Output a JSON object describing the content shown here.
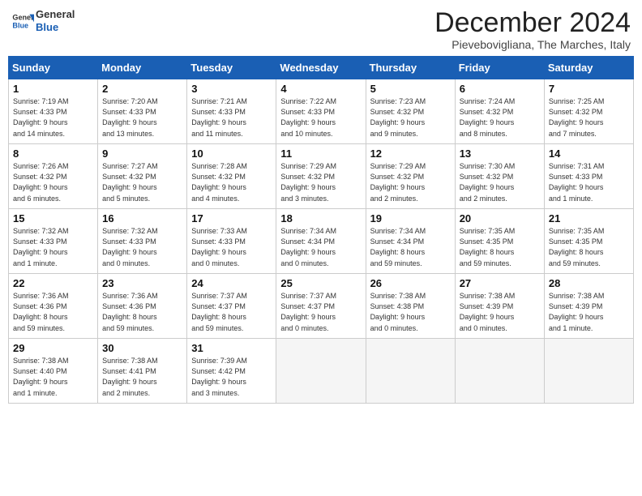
{
  "header": {
    "logo_line1": "General",
    "logo_line2": "Blue",
    "title": "December 2024",
    "subtitle": "Pievebovigliana, The Marches, Italy"
  },
  "days_of_week": [
    "Sunday",
    "Monday",
    "Tuesday",
    "Wednesday",
    "Thursday",
    "Friday",
    "Saturday"
  ],
  "weeks": [
    [
      {
        "day": 1,
        "info": "Sunrise: 7:19 AM\nSunset: 4:33 PM\nDaylight: 9 hours\nand 14 minutes."
      },
      {
        "day": 2,
        "info": "Sunrise: 7:20 AM\nSunset: 4:33 PM\nDaylight: 9 hours\nand 13 minutes."
      },
      {
        "day": 3,
        "info": "Sunrise: 7:21 AM\nSunset: 4:33 PM\nDaylight: 9 hours\nand 11 minutes."
      },
      {
        "day": 4,
        "info": "Sunrise: 7:22 AM\nSunset: 4:33 PM\nDaylight: 9 hours\nand 10 minutes."
      },
      {
        "day": 5,
        "info": "Sunrise: 7:23 AM\nSunset: 4:32 PM\nDaylight: 9 hours\nand 9 minutes."
      },
      {
        "day": 6,
        "info": "Sunrise: 7:24 AM\nSunset: 4:32 PM\nDaylight: 9 hours\nand 8 minutes."
      },
      {
        "day": 7,
        "info": "Sunrise: 7:25 AM\nSunset: 4:32 PM\nDaylight: 9 hours\nand 7 minutes."
      }
    ],
    [
      {
        "day": 8,
        "info": "Sunrise: 7:26 AM\nSunset: 4:32 PM\nDaylight: 9 hours\nand 6 minutes."
      },
      {
        "day": 9,
        "info": "Sunrise: 7:27 AM\nSunset: 4:32 PM\nDaylight: 9 hours\nand 5 minutes."
      },
      {
        "day": 10,
        "info": "Sunrise: 7:28 AM\nSunset: 4:32 PM\nDaylight: 9 hours\nand 4 minutes."
      },
      {
        "day": 11,
        "info": "Sunrise: 7:29 AM\nSunset: 4:32 PM\nDaylight: 9 hours\nand 3 minutes."
      },
      {
        "day": 12,
        "info": "Sunrise: 7:29 AM\nSunset: 4:32 PM\nDaylight: 9 hours\nand 2 minutes."
      },
      {
        "day": 13,
        "info": "Sunrise: 7:30 AM\nSunset: 4:32 PM\nDaylight: 9 hours\nand 2 minutes."
      },
      {
        "day": 14,
        "info": "Sunrise: 7:31 AM\nSunset: 4:33 PM\nDaylight: 9 hours\nand 1 minute."
      }
    ],
    [
      {
        "day": 15,
        "info": "Sunrise: 7:32 AM\nSunset: 4:33 PM\nDaylight: 9 hours\nand 1 minute."
      },
      {
        "day": 16,
        "info": "Sunrise: 7:32 AM\nSunset: 4:33 PM\nDaylight: 9 hours\nand 0 minutes."
      },
      {
        "day": 17,
        "info": "Sunrise: 7:33 AM\nSunset: 4:33 PM\nDaylight: 9 hours\nand 0 minutes."
      },
      {
        "day": 18,
        "info": "Sunrise: 7:34 AM\nSunset: 4:34 PM\nDaylight: 9 hours\nand 0 minutes."
      },
      {
        "day": 19,
        "info": "Sunrise: 7:34 AM\nSunset: 4:34 PM\nDaylight: 8 hours\nand 59 minutes."
      },
      {
        "day": 20,
        "info": "Sunrise: 7:35 AM\nSunset: 4:35 PM\nDaylight: 8 hours\nand 59 minutes."
      },
      {
        "day": 21,
        "info": "Sunrise: 7:35 AM\nSunset: 4:35 PM\nDaylight: 8 hours\nand 59 minutes."
      }
    ],
    [
      {
        "day": 22,
        "info": "Sunrise: 7:36 AM\nSunset: 4:36 PM\nDaylight: 8 hours\nand 59 minutes."
      },
      {
        "day": 23,
        "info": "Sunrise: 7:36 AM\nSunset: 4:36 PM\nDaylight: 8 hours\nand 59 minutes."
      },
      {
        "day": 24,
        "info": "Sunrise: 7:37 AM\nSunset: 4:37 PM\nDaylight: 8 hours\nand 59 minutes."
      },
      {
        "day": 25,
        "info": "Sunrise: 7:37 AM\nSunset: 4:37 PM\nDaylight: 9 hours\nand 0 minutes."
      },
      {
        "day": 26,
        "info": "Sunrise: 7:38 AM\nSunset: 4:38 PM\nDaylight: 9 hours\nand 0 minutes."
      },
      {
        "day": 27,
        "info": "Sunrise: 7:38 AM\nSunset: 4:39 PM\nDaylight: 9 hours\nand 0 minutes."
      },
      {
        "day": 28,
        "info": "Sunrise: 7:38 AM\nSunset: 4:39 PM\nDaylight: 9 hours\nand 1 minute."
      }
    ],
    [
      {
        "day": 29,
        "info": "Sunrise: 7:38 AM\nSunset: 4:40 PM\nDaylight: 9 hours\nand 1 minute."
      },
      {
        "day": 30,
        "info": "Sunrise: 7:38 AM\nSunset: 4:41 PM\nDaylight: 9 hours\nand 2 minutes."
      },
      {
        "day": 31,
        "info": "Sunrise: 7:39 AM\nSunset: 4:42 PM\nDaylight: 9 hours\nand 3 minutes."
      },
      null,
      null,
      null,
      null
    ]
  ]
}
